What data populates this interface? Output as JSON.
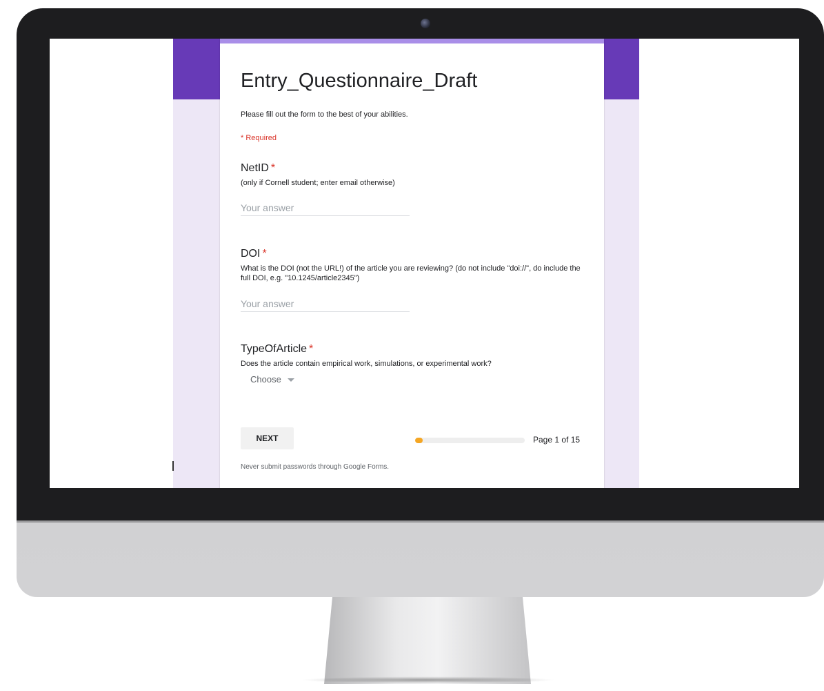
{
  "form": {
    "title": "Entry_Questionnaire_Draft",
    "description": "Please fill out the form to the best of your abilities.",
    "required_note": "* Required",
    "questions": [
      {
        "title": "NetID",
        "required_mark": "*",
        "help": "(only if Cornell student; enter email otherwise)",
        "placeholder": "Your answer"
      },
      {
        "title": "DOI",
        "required_mark": "*",
        "help": "What is the DOI (not the URL!) of the article you are reviewing? (do not include \"doi://\", do include the full DOI, e.g. \"10.1245/article2345\")",
        "placeholder": "Your answer"
      },
      {
        "title": "TypeOfArticle",
        "required_mark": "*",
        "help": "Does the article contain empirical work, simulations, or experimental work?",
        "dropdown_value": "Choose"
      }
    ],
    "next_label": "NEXT",
    "progress": {
      "current": 1,
      "total": 15,
      "label": "Page 1 of 15"
    },
    "footer": "Never submit passwords through Google Forms."
  },
  "colors": {
    "header_purple": "#673ab7",
    "background_lavender": "#ede7f6",
    "required_red": "#d93025",
    "progress_orange": "#f5a623"
  },
  "icons": {
    "dropdown": "caret-down-icon",
    "camera": "webcam-icon"
  }
}
